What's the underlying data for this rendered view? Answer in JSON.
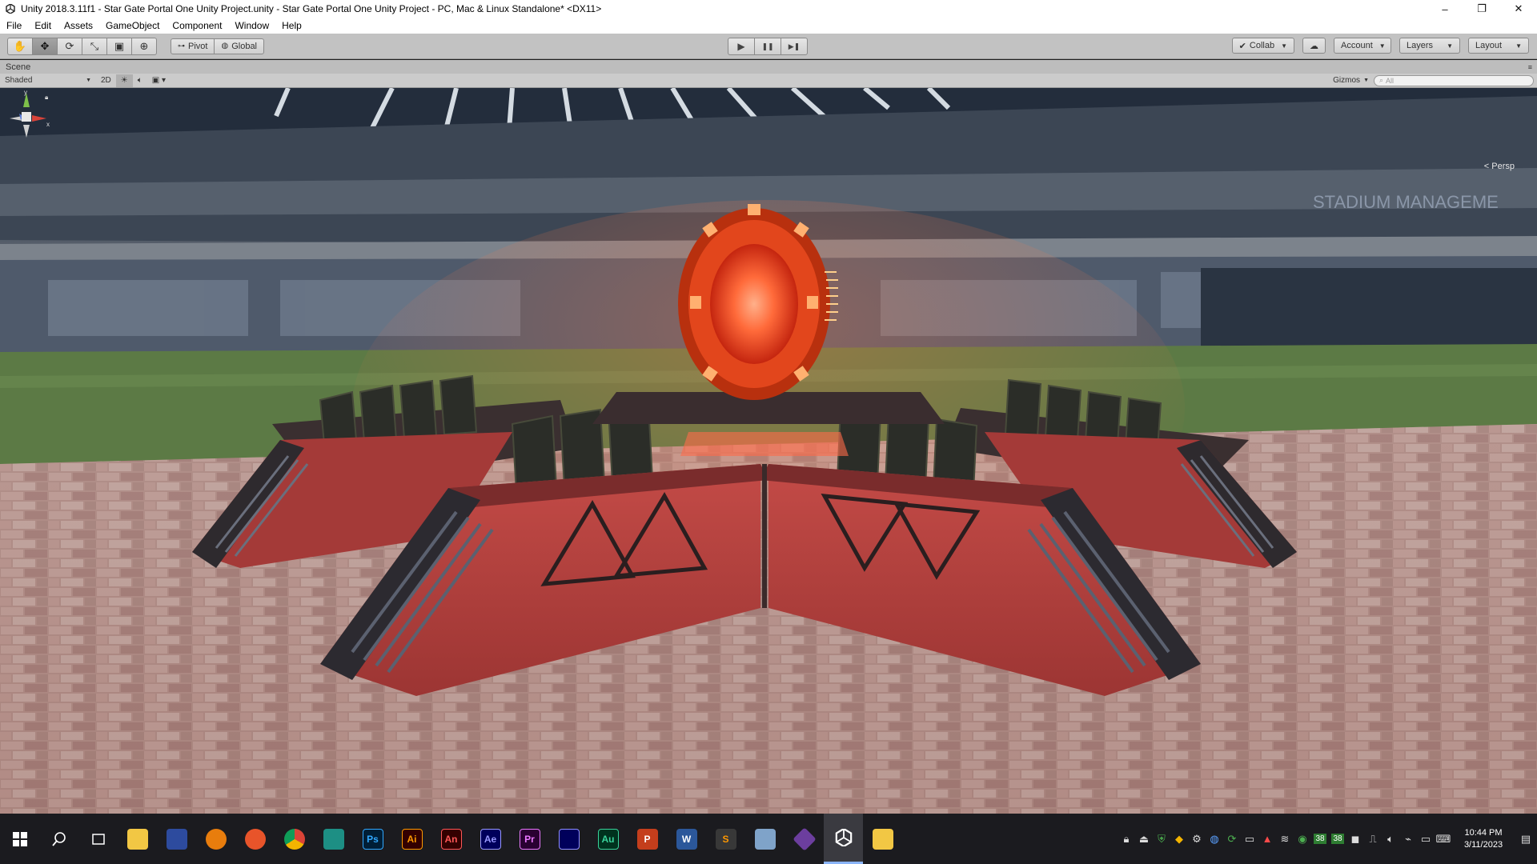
{
  "window": {
    "title": "Unity 2018.3.11f1 - Star Gate Portal One Unity Project.unity - Star Gate Portal One Unity Project - PC, Mac & Linux Standalone* <DX11>",
    "controls": {
      "minimize": "–",
      "restore": "❐",
      "close": "✕"
    }
  },
  "menu": [
    "File",
    "Edit",
    "Assets",
    "GameObject",
    "Component",
    "Window",
    "Help"
  ],
  "toolbar": {
    "tools": [
      {
        "name": "hand-tool",
        "glyph": "✋"
      },
      {
        "name": "move-tool",
        "glyph": "✥"
      },
      {
        "name": "rotate-tool",
        "glyph": "⟳"
      },
      {
        "name": "scale-tool",
        "glyph": "⤡"
      },
      {
        "name": "rect-tool",
        "glyph": "▣"
      },
      {
        "name": "transform-tool",
        "glyph": "⊕"
      }
    ],
    "pivot_label": "Pivot",
    "global_label": "Global",
    "play": "▶",
    "pause": "❚❚",
    "step": "▶❚",
    "collab_label": "Collab",
    "cloud": "☁",
    "account_label": "Account",
    "layers_label": "Layers",
    "layout_label": "Layout"
  },
  "scene": {
    "tab_label": "Scene",
    "shading_mode": "Shaded",
    "mode_2d": "2D",
    "gizmos_label": "Gizmos",
    "search_placeholder": "All",
    "camera_mode": "Persp"
  },
  "colors": {
    "portal_glow": "#ff5a2a",
    "platform_red": "#b8413f",
    "platform_dark": "#3b2e2e"
  },
  "taskbar": {
    "apps": [
      {
        "name": "file-explorer-icon",
        "label": "",
        "bg": "#f2c744",
        "fg": "#8a5a00"
      },
      {
        "name": "app-launcher-icon",
        "label": "",
        "bg": "#2d4b9e",
        "fg": "#fff"
      },
      {
        "name": "blender-icon",
        "label": "",
        "bg": "#e87d0d",
        "fg": "#fff"
      },
      {
        "name": "firefox-icon",
        "label": "",
        "bg": "#e8542a",
        "fg": "#fff"
      },
      {
        "name": "chrome-icon",
        "label": "",
        "bg": "#3a9c4b",
        "fg": "#fff"
      },
      {
        "name": "app-icon",
        "label": "",
        "bg": "#1d8f84",
        "fg": "#fff"
      },
      {
        "name": "photoshop-icon",
        "label": "Ps",
        "bg": "#001e36",
        "fg": "#31a8ff"
      },
      {
        "name": "illustrator-icon",
        "label": "Ai",
        "bg": "#330000",
        "fg": "#ff9a00"
      },
      {
        "name": "animate-icon",
        "label": "An",
        "bg": "#330000",
        "fg": "#ff5757"
      },
      {
        "name": "after-effects-icon",
        "label": "Ae",
        "bg": "#00005b",
        "fg": "#9999ff"
      },
      {
        "name": "premiere-icon",
        "label": "Pr",
        "bg": "#2a0032",
        "fg": "#ea77ff"
      },
      {
        "name": "media-encoder-icon",
        "label": "",
        "bg": "#00005b",
        "fg": "#8f8fff"
      },
      {
        "name": "audition-icon",
        "label": "Au",
        "bg": "#00321e",
        "fg": "#39d39b"
      },
      {
        "name": "powerpoint-icon",
        "label": "P",
        "bg": "#c43e1c",
        "fg": "#fff"
      },
      {
        "name": "word-icon",
        "label": "W",
        "bg": "#2b579a",
        "fg": "#fff"
      },
      {
        "name": "sublime-icon",
        "label": "S",
        "bg": "#383838",
        "fg": "#ff9800"
      },
      {
        "name": "notepad-icon",
        "label": "",
        "bg": "#7fa3c9",
        "fg": "#fff"
      },
      {
        "name": "winrar-icon",
        "label": "",
        "bg": "#6c3e9e",
        "fg": "#fff"
      },
      {
        "name": "unity-icon",
        "label": "",
        "bg": "#ffffff",
        "fg": "#000"
      },
      {
        "name": "folder-icon",
        "label": "",
        "bg": "#f2c744",
        "fg": "#8a5a00"
      }
    ],
    "tray_badges": [
      "38",
      "38"
    ],
    "time": "10:44 PM",
    "date": "3/11/2023"
  }
}
